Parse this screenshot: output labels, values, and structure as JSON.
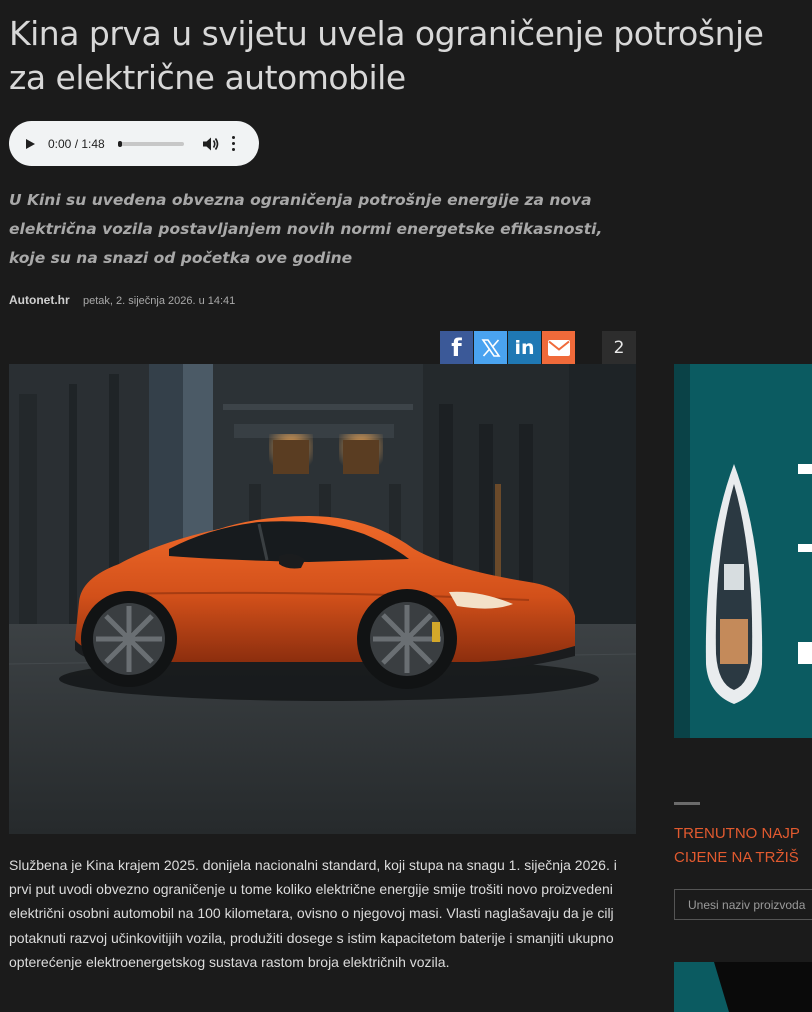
{
  "article": {
    "title": "Kina prva u svijetu uvela ograničenje potrošnje za električne automobile",
    "lead": "U Kini su uvedena obvezna ograničenja potrošnje energije za nova električna vozila postavljanjem novih normi energetske efikasnosti, koje su na snazi od početka ove godine",
    "source": "Autonet.hr",
    "date": "petak, 2. siječnja 2026. u 14:41",
    "body": "Službena je Kina krajem 2025. donijela nacionalni standard, koji stupa na snagu 1. siječnja 2026. i prvi put uvodi obvezno ograničenje u tome koliko električne energije smije trošiti novo proizvedeni električni osobni automobil na 100 kilometara, ovisno o njegovoj masi. Vlasti naglašavaju da je cilj potaknuti razvoj učinkovitijih vozila, produžiti dosege s istim kapacitetom baterije i smanjiti ukupno opterećenje elektroenergetskog sustava rastom broja električnih vozila."
  },
  "audio": {
    "time": "0:00 / 1:48",
    "progress": 0
  },
  "share": {
    "facebook_label": "f",
    "linkedin_label": "in",
    "comment_count": "2"
  },
  "sidebar": {
    "section_title_line1": "TRENUTNO NAJP",
    "section_title_line2": "CIJENE NA TRŽIŠ",
    "search_placeholder": "Unesi naziv proizvoda"
  },
  "colors": {
    "accent": "#e25a2f",
    "background": "#1b1b1b",
    "car": "#e0561e"
  }
}
